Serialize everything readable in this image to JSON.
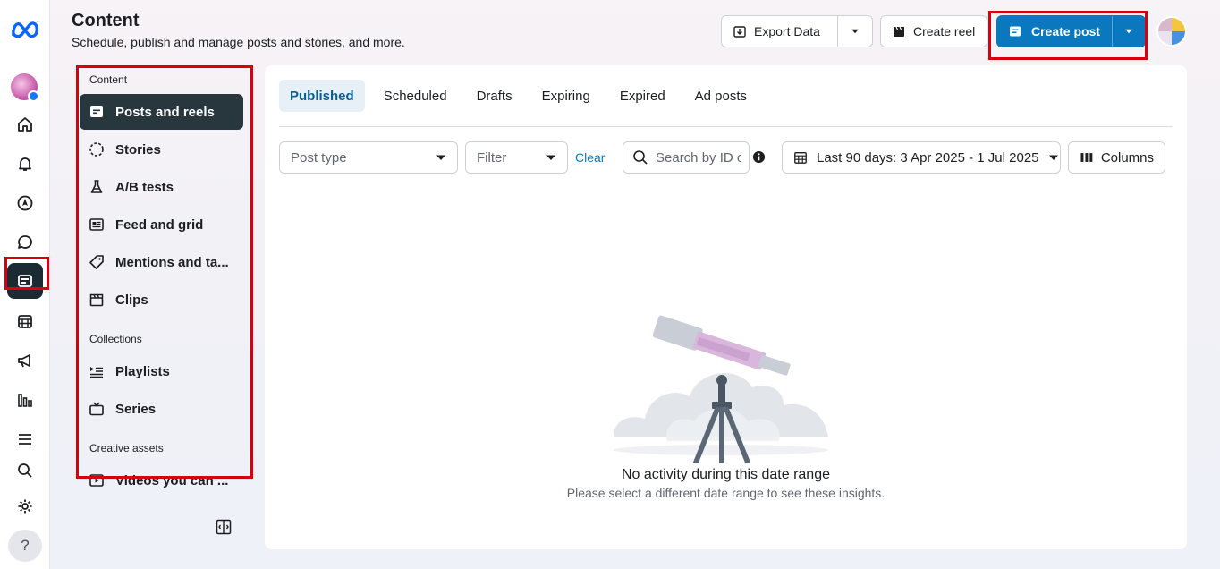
{
  "header": {
    "title": "Content",
    "subtitle": "Schedule, publish and manage posts and stories, and more.",
    "export_label": "Export Data",
    "create_reel_label": "Create reel",
    "create_post_label": "Create post"
  },
  "rail": {
    "items": [
      "home-icon",
      "bell-icon",
      "compass-icon",
      "chat-icon",
      "content-icon",
      "calendar-icon",
      "megaphone-icon",
      "insights-icon",
      "menu-icon",
      "search-icon",
      "gear-icon"
    ],
    "active": "content-icon",
    "help_label": "?"
  },
  "sidebar": {
    "section_content": "Content",
    "section_collections": "Collections",
    "section_assets": "Creative assets",
    "items": [
      {
        "label": "Posts and reels",
        "icon": "post-icon",
        "active": true
      },
      {
        "label": "Stories",
        "icon": "story-ring-icon"
      },
      {
        "label": "A/B tests",
        "icon": "flask-icon"
      },
      {
        "label": "Feed and grid",
        "icon": "feed-icon"
      },
      {
        "label": "Mentions and ta...",
        "icon": "tag-icon"
      },
      {
        "label": "Clips",
        "icon": "clapper-icon"
      },
      {
        "label": "Playlists",
        "icon": "playlist-icon"
      },
      {
        "label": "Series",
        "icon": "tv-icon"
      },
      {
        "label": "Videos you can ...",
        "icon": "video-icon"
      }
    ]
  },
  "tabs": [
    "Published",
    "Scheduled",
    "Drafts",
    "Expiring",
    "Expired",
    "Ad posts"
  ],
  "active_tab": "Published",
  "filters": {
    "post_type": "Post type",
    "filter": "Filter",
    "clear": "Clear",
    "search_placeholder": "Search by ID or",
    "date_range": "Last 90 days: 3 Apr 2025 - 1 Jul 2025",
    "columns": "Columns"
  },
  "empty_state": {
    "title": "No activity during this date range",
    "subtitle": "Please select a different date range to see these insights."
  },
  "colors": {
    "primary": "#0a78be",
    "active_nav": "#28363e",
    "highlight": "#d9000d"
  }
}
